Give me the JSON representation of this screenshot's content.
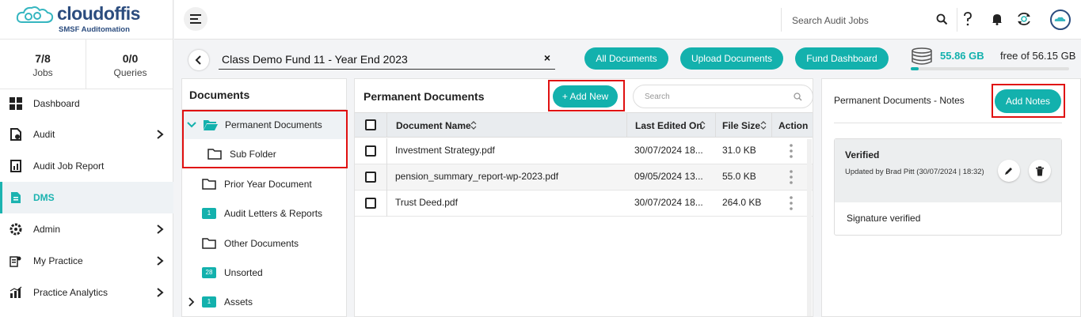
{
  "brand": {
    "name": "cloudoffis",
    "subtitle": "SMSF Auditomation"
  },
  "stats": [
    {
      "value": "7/8",
      "label": "Jobs"
    },
    {
      "value": "0/0",
      "label": "Queries"
    }
  ],
  "nav": {
    "items": [
      {
        "label": "Dashboard",
        "icon": "grid-icon"
      },
      {
        "label": "Audit",
        "icon": "audit-document-icon"
      },
      {
        "label": "Audit Job Report",
        "icon": "report-icon"
      },
      {
        "label": "DMS",
        "icon": "document-icon"
      },
      {
        "label": "Admin",
        "icon": "admin-gear-icon"
      },
      {
        "label": "My Practice",
        "icon": "practice-icon"
      },
      {
        "label": "Practice Analytics",
        "icon": "analytics-chart-icon"
      }
    ]
  },
  "topbar": {
    "search_placeholder": "Search Audit Jobs"
  },
  "job": {
    "title": "Class Demo Fund 11  - Year End 2023",
    "clear": "×"
  },
  "actions": {
    "all_documents": "All Documents",
    "upload_documents": "Upload Documents",
    "fund_dashboard": "Fund Dashboard"
  },
  "storage": {
    "used": "55.86 GB",
    "rest": "free of 56.15 GB",
    "used_fraction": 0.05
  },
  "tree": {
    "heading": "Documents",
    "items": [
      {
        "label": "Permanent Documents"
      },
      {
        "label": "Sub Folder"
      },
      {
        "label": "Prior Year Document"
      },
      {
        "label": "Audit Letters & Reports",
        "badge": "1"
      },
      {
        "label": "Other Documents"
      },
      {
        "label": "Unsorted",
        "badge": "28"
      },
      {
        "label": "Assets",
        "badge": "1"
      }
    ]
  },
  "docs": {
    "title": "Permanent Documents",
    "add_new": "+ Add New",
    "search_placeholder": "Search",
    "columns": {
      "name": "Document Name",
      "edited": "Last Edited On",
      "size": "File Size",
      "action": "Action"
    },
    "rows": [
      {
        "name": "Investment Strategy.pdf",
        "edited": "30/07/2024 18...",
        "size": "31.0 KB"
      },
      {
        "name": "pension_summary_report-wp-2023.pdf",
        "edited": "09/05/2024 13...",
        "size": "55.0 KB"
      },
      {
        "name": "Trust Deed.pdf",
        "edited": "30/07/2024 18...",
        "size": "264.0 KB"
      }
    ]
  },
  "notes": {
    "title": "Permanent Documents - Notes",
    "add_notes": "Add Notes",
    "note": {
      "status": "Verified",
      "meta": "Updated by Brad Pitt (30/07/2024 | 18:32)",
      "body": "Signature verified"
    }
  },
  "colors": {
    "accent": "#13b1ad",
    "brand": "#2b4c7e",
    "highlight": "#e01010"
  }
}
